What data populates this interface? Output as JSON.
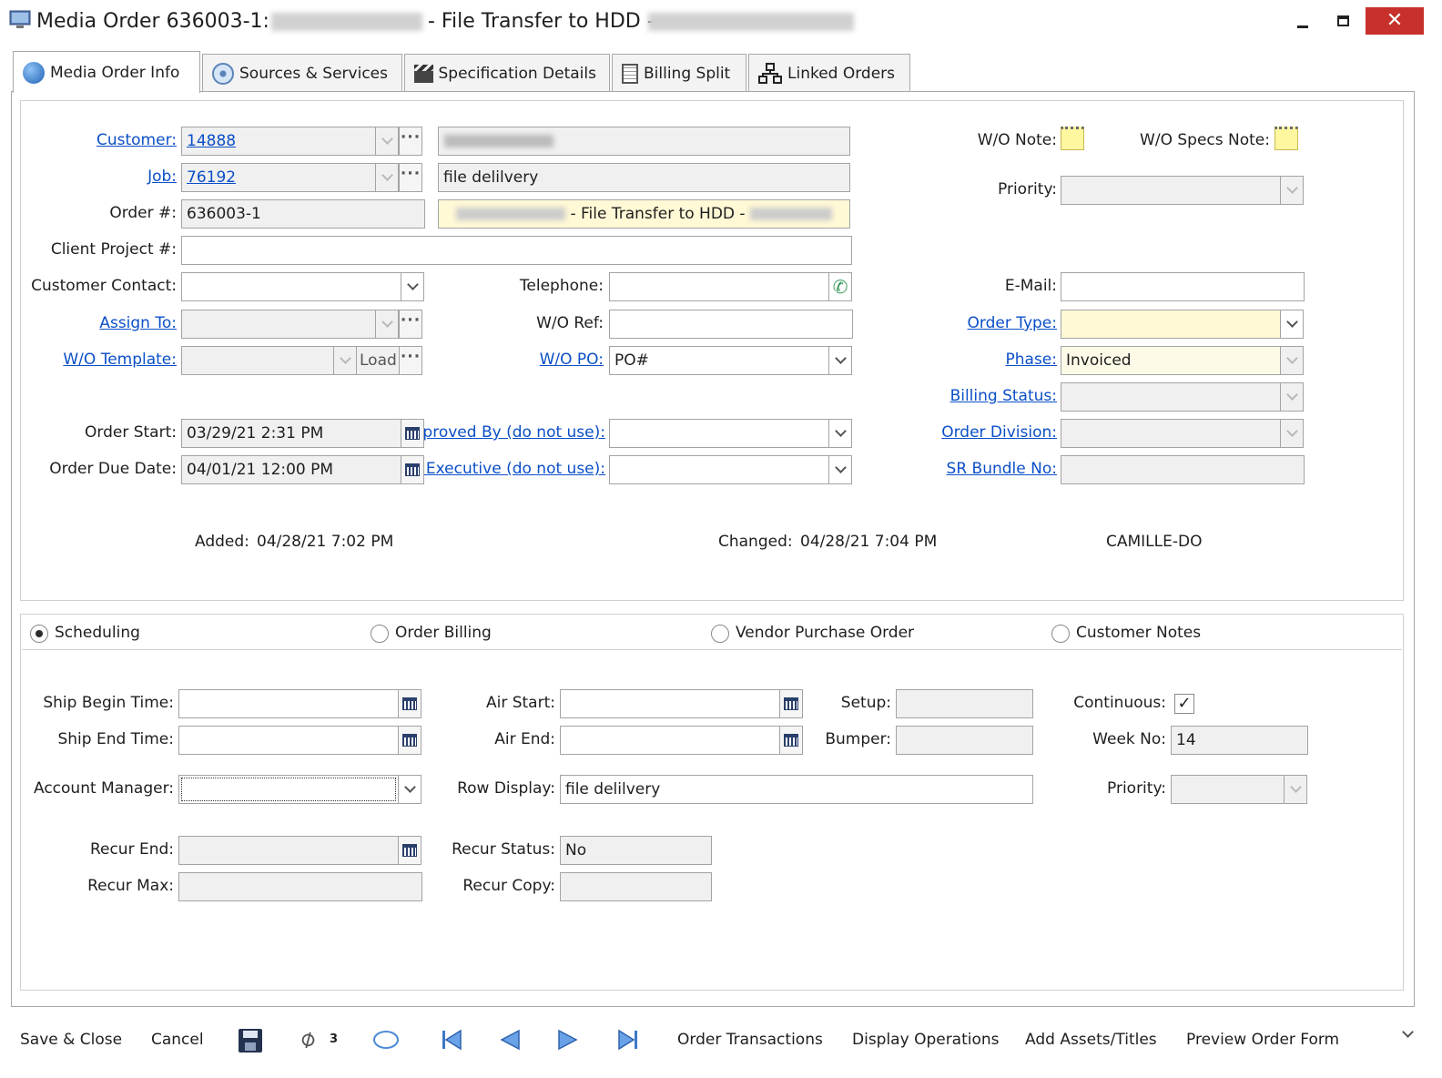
{
  "window": {
    "title_prefix": "Media Order 636003-1:",
    "title_middle": "- File Transfer to HDD -"
  },
  "tabs": [
    {
      "label": "Media Order Info"
    },
    {
      "label": "Sources & Services"
    },
    {
      "label": "Specification Details"
    },
    {
      "label": "Billing Split"
    },
    {
      "label": "Linked Orders"
    }
  ],
  "form": {
    "customer": {
      "label": "Customer:",
      "value": "14888"
    },
    "job": {
      "label": "Job:",
      "value": "76192",
      "description": "file delilvery"
    },
    "order_no": {
      "label": "Order #:",
      "value": "636003-1",
      "title_text": "- File Transfer to HDD -"
    },
    "client_project": {
      "label": "Client Project #:",
      "value": ""
    },
    "customer_contact": {
      "label": "Customer Contact:"
    },
    "telephone": {
      "label": "Telephone:"
    },
    "email": {
      "label": "E-Mail:"
    },
    "assign_to": {
      "label": "Assign To:"
    },
    "wo_ref": {
      "label": "W/O Ref:"
    },
    "order_type": {
      "label": "Order Type:"
    },
    "wo_template": {
      "label": "W/O Template:",
      "load": "Load"
    },
    "wo_po": {
      "label": "W/O PO:",
      "value": "PO#"
    },
    "phase": {
      "label": "Phase:",
      "value": "Invoiced"
    },
    "billing_status": {
      "label": "Billing Status:"
    },
    "order_start": {
      "label": "Order Start:",
      "value": "03/29/21 2:31 PM"
    },
    "approved_by": {
      "label": "pproved By (do not use):"
    },
    "order_division": {
      "label": "Order Division:"
    },
    "order_due": {
      "label": "Order Due Date:",
      "value": "04/01/21 12:00 PM"
    },
    "executive": {
      "label": "t Executive (do not use):"
    },
    "sr_bundle": {
      "label": "SR Bundle No:"
    },
    "wo_note": {
      "label": "W/O Note:"
    },
    "wo_specs_note": {
      "label": "W/O Specs Note:"
    },
    "priority": {
      "label": "Priority:"
    },
    "added": {
      "label": "Added:",
      "value": "04/28/21 7:02 PM"
    },
    "changed": {
      "label": "Changed:",
      "value": "04/28/21 7:04 PM"
    },
    "changed_by": "CAMILLE-DO"
  },
  "sections": [
    {
      "label": "Scheduling",
      "selected": true
    },
    {
      "label": "Order Billing",
      "selected": false
    },
    {
      "label": "Vendor Purchase Order",
      "selected": false
    },
    {
      "label": "Customer Notes",
      "selected": false
    }
  ],
  "scheduling": {
    "ship_begin": {
      "label": "Ship Begin Time:"
    },
    "ship_end": {
      "label": "Ship End Time:"
    },
    "account_manager": {
      "label": "Account Manager:"
    },
    "recur_end": {
      "label": "Recur End:"
    },
    "recur_max": {
      "label": "Recur Max:"
    },
    "air_start": {
      "label": "Air Start:"
    },
    "air_end": {
      "label": "Air End:"
    },
    "row_display": {
      "label": "Row Display:",
      "value": "file delilvery"
    },
    "recur_status": {
      "label": "Recur Status:",
      "value": "No"
    },
    "recur_copy": {
      "label": "Recur Copy:"
    },
    "setup": {
      "label": "Setup:"
    },
    "bumper": {
      "label": "Bumper:"
    },
    "continuous": {
      "label": "Continuous:",
      "checked": true
    },
    "week_no": {
      "label": "Week No:",
      "value": "14"
    },
    "priority": {
      "label": "Priority:"
    }
  },
  "toolbar": {
    "save_close": "Save & Close",
    "cancel": "Cancel",
    "attachments_count": "3",
    "order_transactions": "Order Transactions",
    "display_operations": "Display Operations",
    "add_assets": "Add Assets/Titles",
    "preview_order_form": "Preview Order Form"
  },
  "colors": {
    "link": "#0b4fc8",
    "close_button": "#c8302b",
    "required_field": "#fff9d6"
  }
}
